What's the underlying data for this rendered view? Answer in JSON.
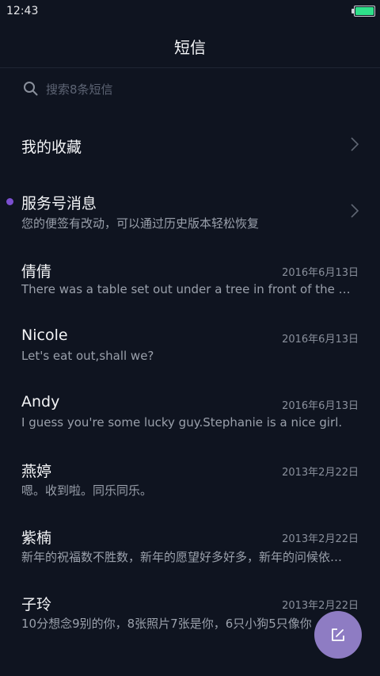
{
  "status_bar": {
    "time": "12:43",
    "battery_color": "#2fe08a"
  },
  "header": {
    "title": "短信"
  },
  "search": {
    "placeholder": "搜索8条短信",
    "icon": "search-icon"
  },
  "favorites": {
    "label": "我的收藏",
    "icon": "chevron-right-icon"
  },
  "service": {
    "label": "服务号消息",
    "preview": "您的便签有改动，可以通过历史版本轻松恢复",
    "unread_dot_color": "#7b4fd0",
    "icon": "chevron-right-icon"
  },
  "conversations": [
    {
      "name": "倩倩",
      "date": "2016年6月13日",
      "preview": "There was a table set out under a tree in front of the hous"
    },
    {
      "name": "Nicole",
      "date": "2016年6月13日",
      "preview": "Let's eat out,shall we?"
    },
    {
      "name": "Andy",
      "date": "2016年6月13日",
      "preview": "I guess you're some lucky guy.Stephanie is a nice girl."
    },
    {
      "name": "燕婷",
      "date": "2013年2月22日",
      "preview": "嗯。收到啦。同乐同乐。"
    },
    {
      "name": "紫楠",
      "date": "2013年2月22日",
      "preview": "新年的祝福数不胜数，新年的愿望好多好多，新年的问候依…"
    },
    {
      "name": "子玲",
      "date": "2013年2月22日",
      "preview": "10分想念9别的你，8张照片7张是你，6只小狗5只像你"
    }
  ],
  "fab": {
    "icon": "compose-icon",
    "color": "#8e7cc3"
  }
}
